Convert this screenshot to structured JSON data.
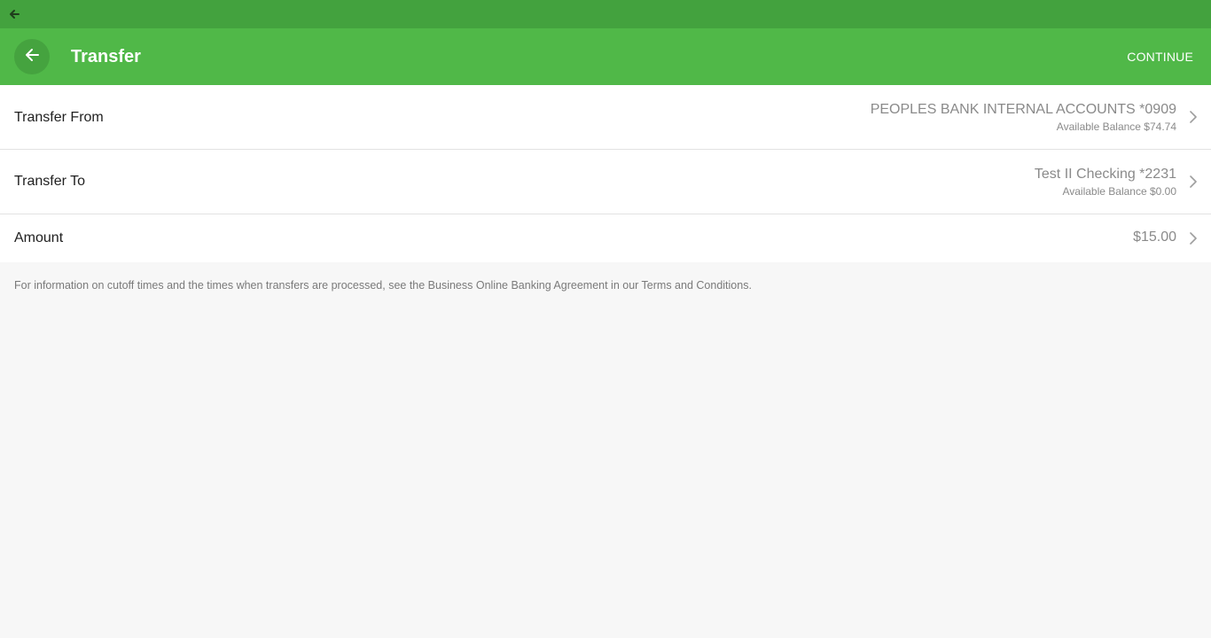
{
  "system_bar": {
    "back_icon": "arrow-left-icon"
  },
  "header": {
    "back_icon": "arrow-left-icon",
    "title": "Transfer",
    "continue_label": "CONTINUE",
    "colors": {
      "system_bar": "#43a23e",
      "app_bar": "#50b848"
    }
  },
  "form": {
    "transfer_from": {
      "label": "Transfer From",
      "account": "PEOPLES BANK INTERNAL ACCOUNTS *0909",
      "balance": "Available Balance $74.74"
    },
    "transfer_to": {
      "label": "Transfer To",
      "account": "Test II Checking *2231",
      "balance": "Available Balance $0.00"
    },
    "amount": {
      "label": "Amount",
      "value": "$15.00"
    },
    "chevron_icon": "chevron-right-icon"
  },
  "info": {
    "text": "For information on cutoff times and the times when transfers are processed, see the Business Online Banking Agreement in our Terms and Conditions."
  }
}
